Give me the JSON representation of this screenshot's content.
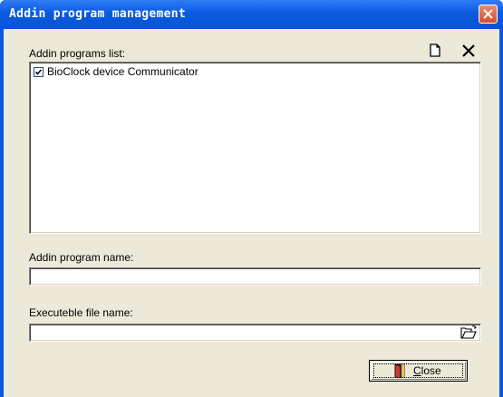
{
  "window": {
    "title": "Addin program management",
    "close_icon": "close-x-icon"
  },
  "list_section": {
    "label": "Addin programs list:",
    "new_icon": "new-document-icon",
    "delete_icon": "delete-x-icon",
    "items": [
      {
        "label": "BioClock device Communicator",
        "checked": true
      }
    ]
  },
  "name_field": {
    "label": "Addin program name:",
    "value": ""
  },
  "file_field": {
    "label": "Executeble file name:",
    "value": "",
    "browse_icon": "open-folder-icon"
  },
  "close_button": {
    "mnemonic": "C",
    "label_rest": "lose",
    "icon": "door-icon"
  },
  "colors": {
    "titlebar": "#0a5ae0",
    "client_bg": "#ece9d8",
    "close_x_bg": "#d4502c"
  }
}
